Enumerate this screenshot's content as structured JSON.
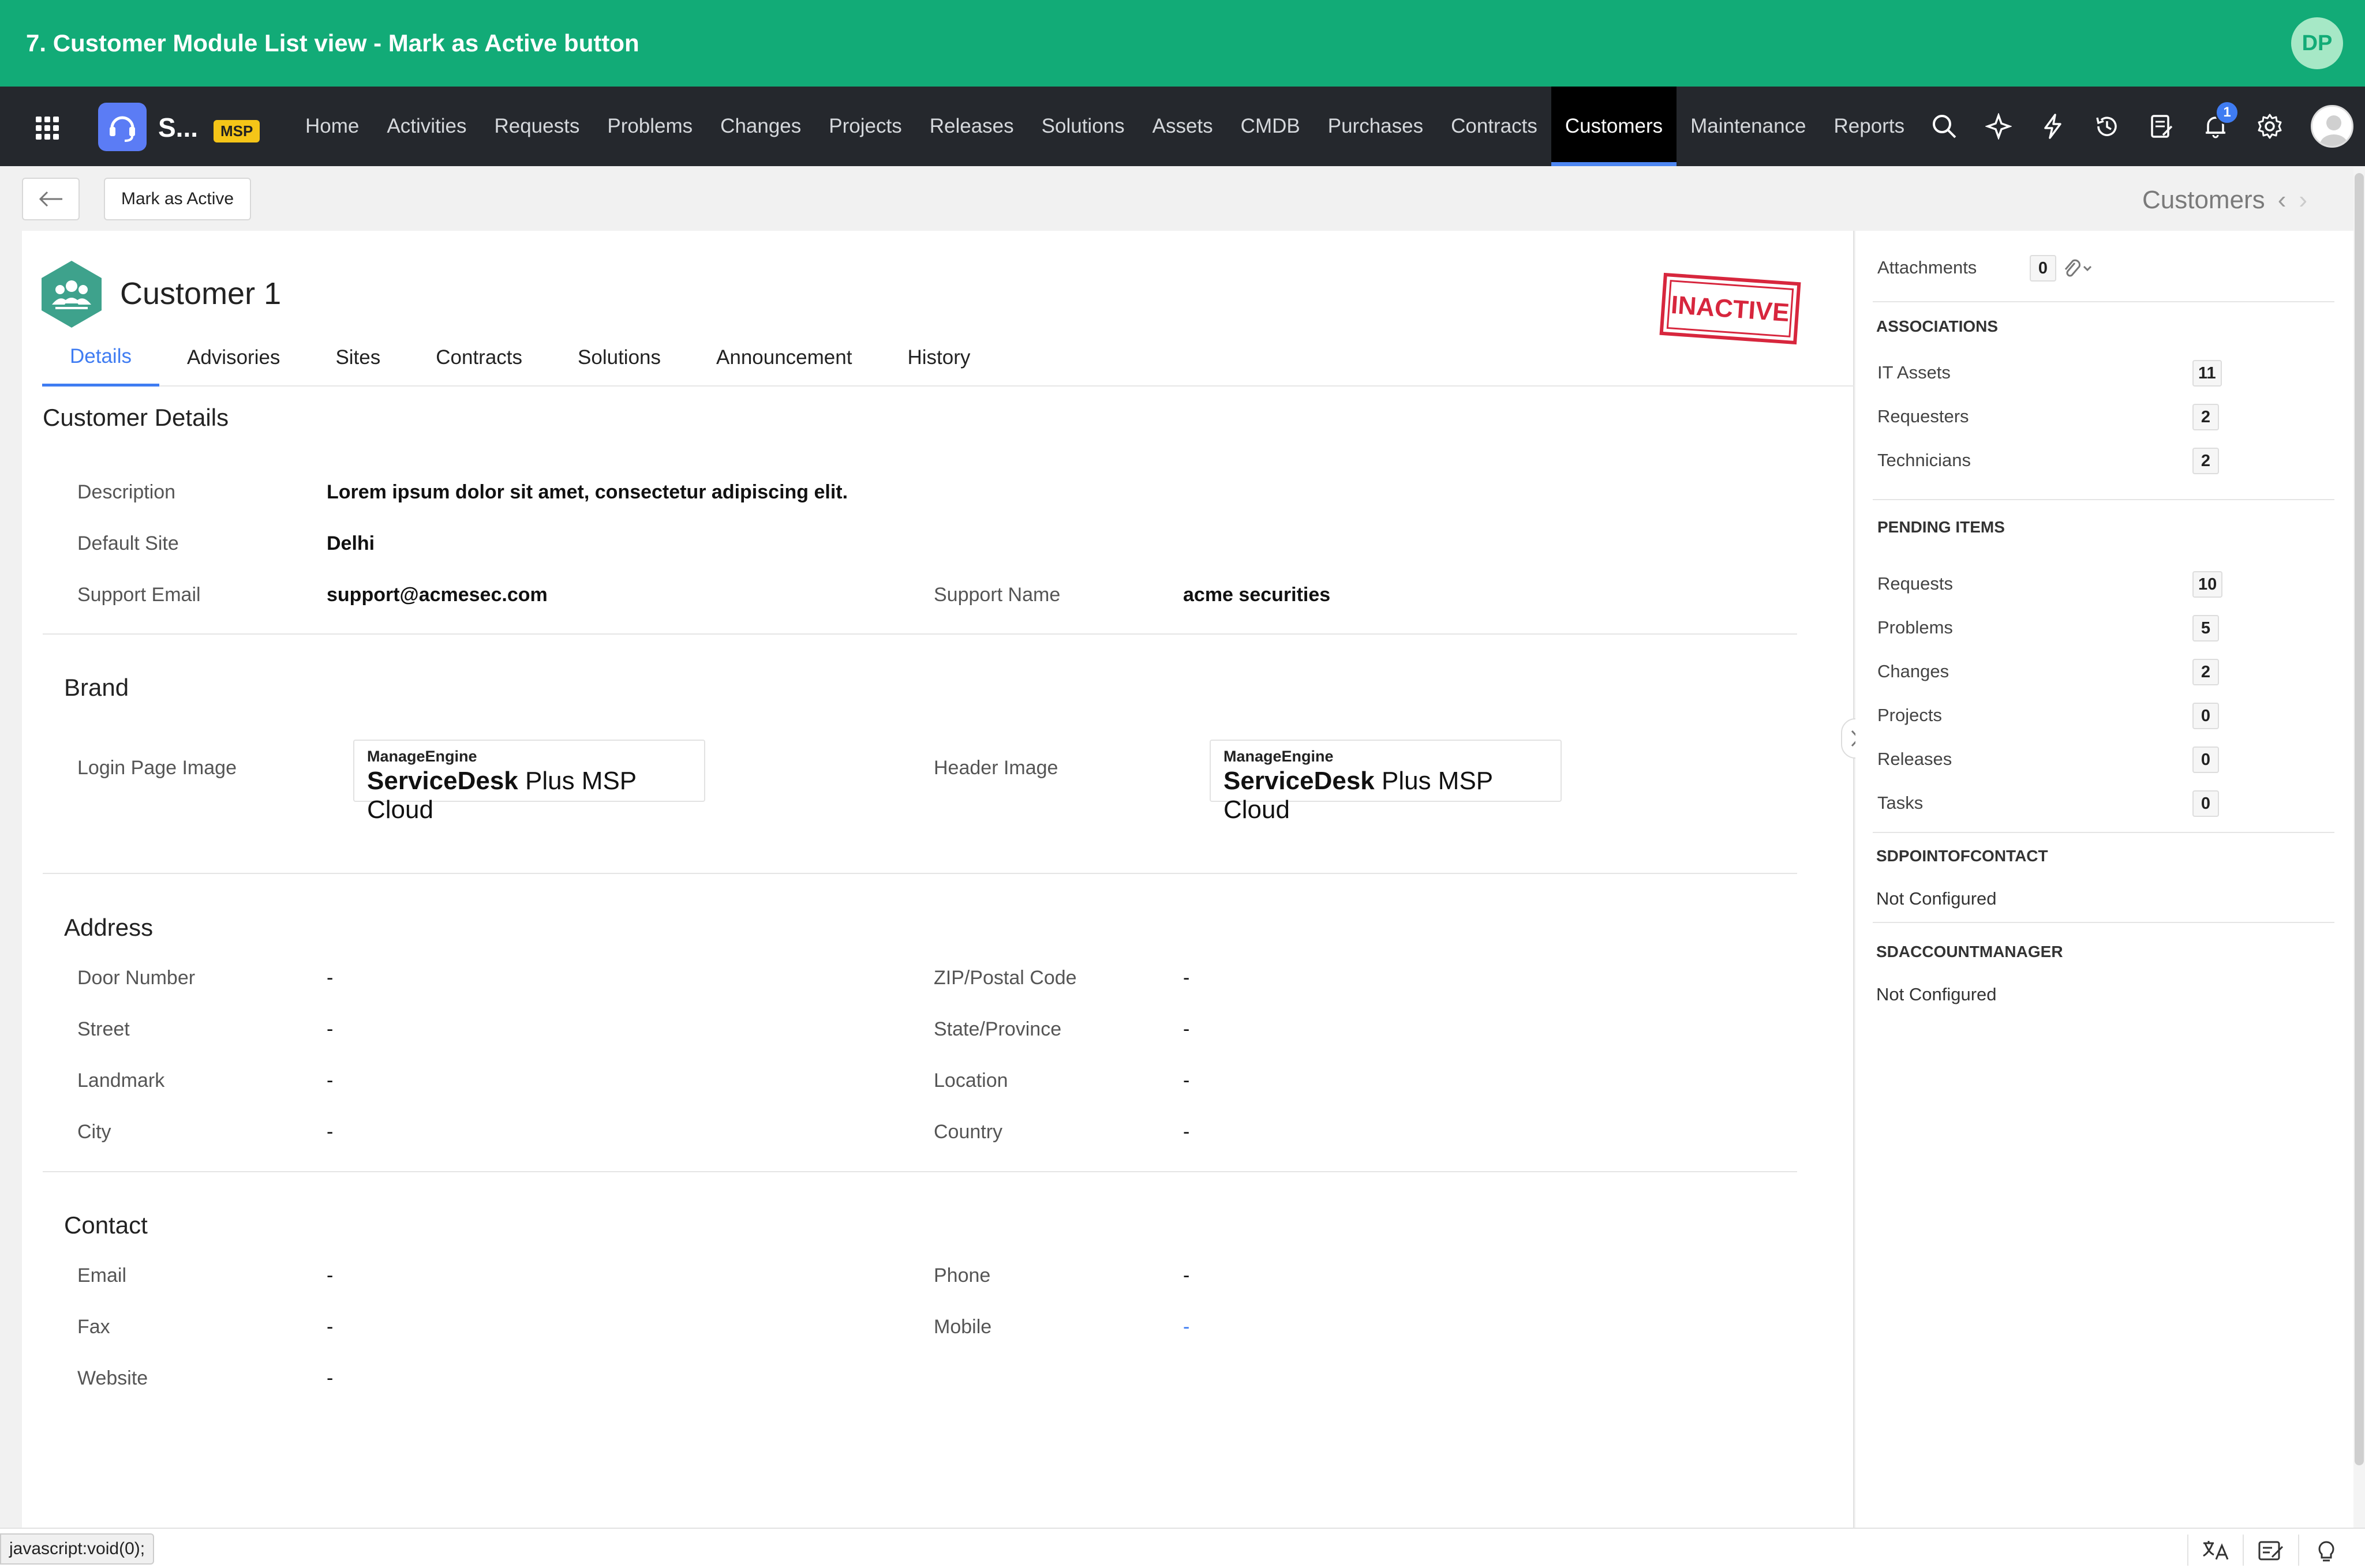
{
  "banner": {
    "title": "7. Customer Module List view - Mark as Active button",
    "avatar_initials": "DP"
  },
  "topnav": {
    "brand_name": "S...",
    "badge": "MSP",
    "items": [
      {
        "label": "Home"
      },
      {
        "label": "Activities"
      },
      {
        "label": "Requests"
      },
      {
        "label": "Problems"
      },
      {
        "label": "Changes"
      },
      {
        "label": "Projects"
      },
      {
        "label": "Releases"
      },
      {
        "label": "Solutions"
      },
      {
        "label": "Assets"
      },
      {
        "label": "CMDB"
      },
      {
        "label": "Purchases"
      },
      {
        "label": "Contracts"
      },
      {
        "label": "Customers"
      },
      {
        "label": "Maintenance"
      },
      {
        "label": "Reports"
      }
    ],
    "active_item": "Customers",
    "notification_count": "1"
  },
  "toolbar": {
    "mark_active_label": "Mark as Active",
    "breadcrumb": "Customers"
  },
  "customer": {
    "title": "Customer 1",
    "status_stamp": "INACTIVE",
    "tabs": [
      {
        "label": "Details"
      },
      {
        "label": "Advisories"
      },
      {
        "label": "Sites"
      },
      {
        "label": "Contracts"
      },
      {
        "label": "Solutions"
      },
      {
        "label": "Announcement"
      },
      {
        "label": "History"
      }
    ],
    "active_tab": "Details"
  },
  "details": {
    "section_title": "Customer Details",
    "description_label": "Description",
    "description_value": "Lorem ipsum dolor sit amet, consectetur adipiscing elit.",
    "default_site_label": "Default Site",
    "default_site_value": "Delhi",
    "support_email_label": "Support Email",
    "support_email_value": "support@acmesec.com",
    "support_name_label": "Support Name",
    "support_name_value": "acme securities"
  },
  "brand": {
    "section_title": "Brand",
    "login_label": "Login Page Image",
    "header_label": "Header Image",
    "logo_vendor": "ManageEngine",
    "logo_product_bold": "ServiceDesk",
    "logo_product_rest": " Plus MSP Cloud"
  },
  "address": {
    "section_title": "Address",
    "door_label": "Door Number",
    "door_value": "-",
    "street_label": "Street",
    "street_value": "-",
    "landmark_label": "Landmark",
    "landmark_value": "-",
    "city_label": "City",
    "city_value": "-",
    "zip_label": "ZIP/Postal Code",
    "zip_value": "-",
    "state_label": "State/Province",
    "state_value": "-",
    "location_label": "Location",
    "location_value": "-",
    "country_label": "Country",
    "country_value": "-"
  },
  "contact": {
    "section_title": "Contact",
    "email_label": "Email",
    "email_value": "-",
    "fax_label": "Fax",
    "fax_value": "-",
    "website_label": "Website",
    "website_value": "-",
    "phone_label": "Phone",
    "phone_value": "-",
    "mobile_label": "Mobile",
    "mobile_value": "-"
  },
  "sidebar": {
    "attachments_label": "Attachments",
    "attachments_count": "0",
    "associations_header": "ASSOCIATIONS",
    "associations": [
      {
        "label": "IT Assets",
        "count": "11"
      },
      {
        "label": "Requesters",
        "count": "2"
      },
      {
        "label": "Technicians",
        "count": "2"
      }
    ],
    "pending_header": "PENDING ITEMS",
    "pending": [
      {
        "label": "Requests",
        "count": "10"
      },
      {
        "label": "Problems",
        "count": "5"
      },
      {
        "label": "Changes",
        "count": "2"
      },
      {
        "label": "Projects",
        "count": "0"
      },
      {
        "label": "Releases",
        "count": "0"
      },
      {
        "label": "Tasks",
        "count": "0"
      }
    ],
    "poc_header": "SDPOINTOFCONTACT",
    "poc_value": "Not Configured",
    "am_header": "SDACCOUNTMANAGER",
    "am_value": "Not Configured"
  },
  "statusbar": {
    "url": "javascript:void(0);"
  },
  "colors": {
    "banner": "#12ab77",
    "nav_bg": "#25282d",
    "accent": "#3f7cf2",
    "stamp": "#d7263d",
    "badge": "#f5c518"
  },
  "icons": [
    "apps-grid-icon",
    "headset-icon",
    "search-icon",
    "magic-icon",
    "lightning-icon",
    "history-icon",
    "notes-icon",
    "bell-icon",
    "gear-icon",
    "back-arrow-icon",
    "chevron-left-icon",
    "chevron-right-icon",
    "paperclip-icon",
    "customer-group-icon",
    "translate-icon",
    "edit-note-icon",
    "bulb-icon"
  ]
}
